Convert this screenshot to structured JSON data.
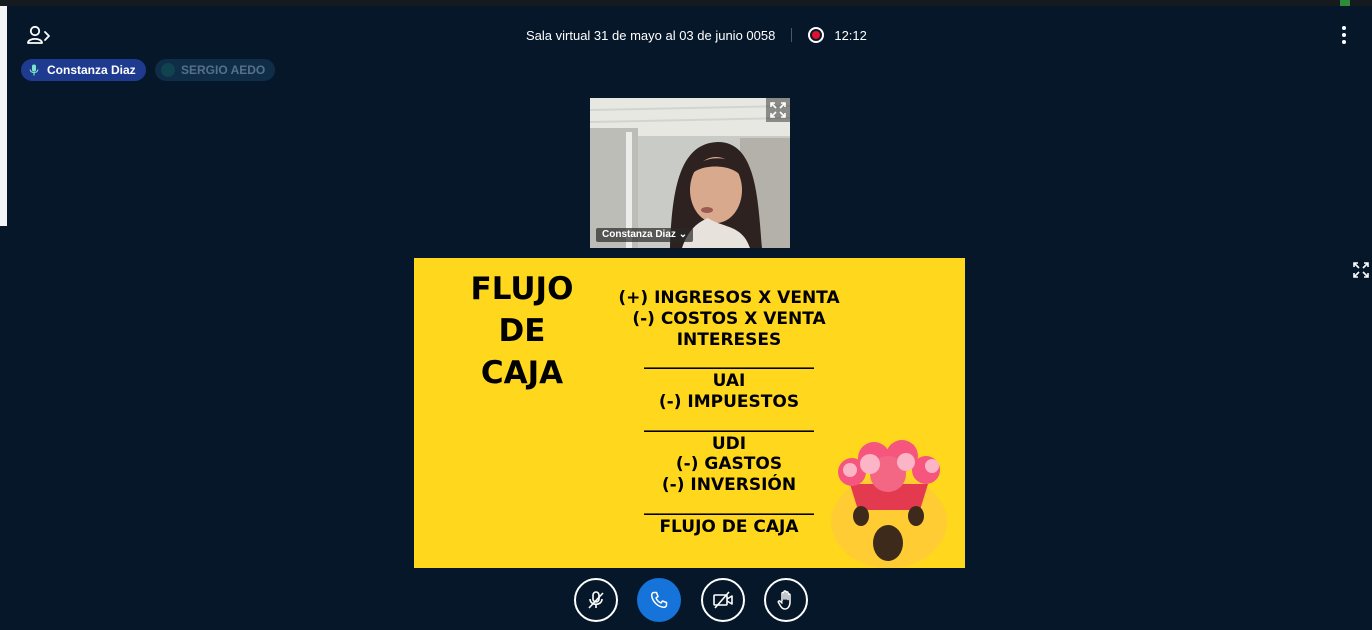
{
  "header": {
    "meeting_title": "Sala virtual 31 de mayo al 03 de junio 0058",
    "recording_time": "12:12",
    "users_icon": "user-list-toggle-icon",
    "options_icon": "kebab-menu-icon"
  },
  "talkers": [
    {
      "name": "Constanza Diaz",
      "state": "talking",
      "icon": "microphone-icon",
      "color": "#1f3b8f"
    },
    {
      "name": "SERGIO AEDO",
      "state": "idle",
      "icon": "dot-icon",
      "color": "#0f2d47"
    }
  ],
  "webcam": {
    "participant": "Constanza Diaz",
    "dropdown_icon": "chevron-down-icon",
    "expand_icon": "fullscreen-icon"
  },
  "presentation": {
    "title_lines": [
      "FLUJO",
      "DE",
      "CAJA"
    ],
    "lines": [
      "(+) INGRESOS X VENTA",
      "(-) COSTOS X VENTA",
      "INTERESES",
      "____________________",
      "UAI",
      "(-) IMPUESTOS",
      "____________________",
      "UDI",
      "(-) GASTOS",
      "(-) INVERSIÓN",
      "____________________",
      "FLUJO DE CAJA"
    ],
    "background": "#ffd71c",
    "emoji": "exploding-head-emoji"
  },
  "controls": [
    {
      "name": "mute-audio-button",
      "icon": "microphone-off-icon"
    },
    {
      "name": "leave-audio-button",
      "icon": "phone-icon"
    },
    {
      "name": "share-webcam-button",
      "icon": "camera-off-icon"
    },
    {
      "name": "raise-hand-button",
      "icon": "hand-icon"
    }
  ],
  "colors": {
    "background": "#06172a",
    "accent_blue": "#1673d9",
    "recording_red": "#e0112f"
  }
}
